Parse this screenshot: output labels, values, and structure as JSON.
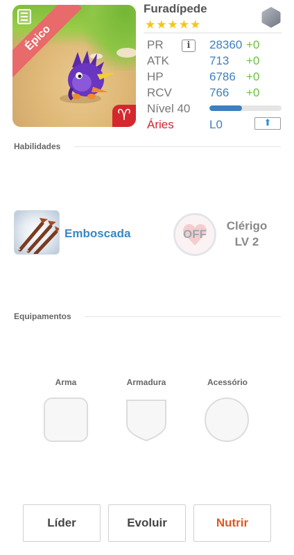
{
  "monster": {
    "rarity_label": "Épico",
    "name": "Furadípede",
    "stars": "★★★★★",
    "star_count": 5,
    "element_icon": "rock-element-icon",
    "sign_symbol": "♈"
  },
  "stats": {
    "pr_label": "PR",
    "pr_value": "28360",
    "pr_bonus": "+0",
    "info_label": "i",
    "atk_label": "ATK",
    "atk_value": "713",
    "atk_bonus": "+0",
    "hp_label": "HP",
    "hp_value": "6786",
    "hp_bonus": "+0",
    "rcv_label": "RCV",
    "rcv_value": "766",
    "rcv_bonus": "+0",
    "level_label": "Nível 40",
    "level_progress": 0.45,
    "sign_label": "Áries",
    "sign_level": "L0",
    "upgrade_icon": "⬆"
  },
  "abilities": {
    "title": "Habilidades",
    "skill_name": "Emboscada",
    "leader_status": "OFF",
    "leader_name": "Clérigo",
    "leader_level": "LV 2"
  },
  "equipment": {
    "title": "Equipamentos",
    "weapon_label": "Arma",
    "armor_label": "Armadura",
    "accessory_label": "Acessório"
  },
  "actions": {
    "leader_label": "Líder",
    "evolve_label": "Evoluir",
    "feed_label": "Nutrir"
  },
  "colors": {
    "accent_blue": "#3d7fbf",
    "bonus_green": "#6bbf3e",
    "sign_red": "#d0262d",
    "feed_orange": "#e0571f",
    "epic_ribbon": "#e86a6a",
    "star_gold": "#f5c518"
  }
}
